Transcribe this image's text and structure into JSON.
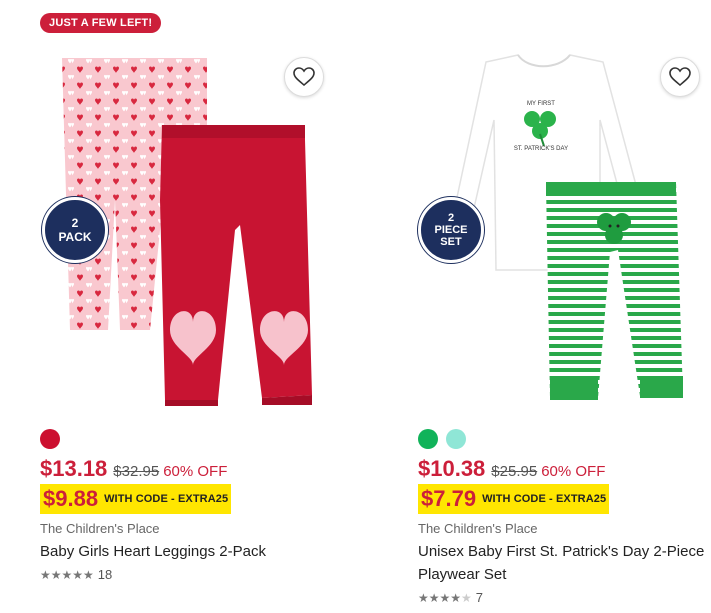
{
  "products": [
    {
      "flag": "JUST A FEW LEFT!",
      "pack_line1": "2",
      "pack_line2": "PACK",
      "swatches": [
        "#cc1030"
      ],
      "price_now": "$13.18",
      "price_was": "$32.95",
      "discount": "60% OFF",
      "promo_price": "$9.88",
      "promo_code": "WITH CODE - EXTRA25",
      "brand": "The Children's Place",
      "title": "Baby Girls Heart Leggings 2-Pack",
      "stars": "★★★★★",
      "rating_count": "18",
      "image_icon": "leggings-image"
    },
    {
      "flag": "",
      "pack_line1": "2",
      "pack_line2": "PIECE",
      "pack_line3": "SET",
      "swatches": [
        "#11b35a",
        "#8fe6d6"
      ],
      "price_now": "$10.38",
      "price_was": "$25.95",
      "discount": "60% OFF",
      "promo_price": "$7.79",
      "promo_code": "WITH CODE - EXTRA25",
      "brand": "The Children's Place",
      "title": "Unisex Baby First St. Patrick's Day 2-Piece Playwear Set",
      "stars": "★★★★",
      "stars_off": "★",
      "rating_count": "7",
      "bodysuit_text1": "MY FIRST",
      "bodysuit_text2": "ST. PATRICK'S DAY",
      "image_icon": "playwear-set-image"
    }
  ],
  "colors": {
    "sale_red": "#cc1f3a",
    "promo_yellow": "#ffe600",
    "badge_navy": "#1d2f5e"
  }
}
